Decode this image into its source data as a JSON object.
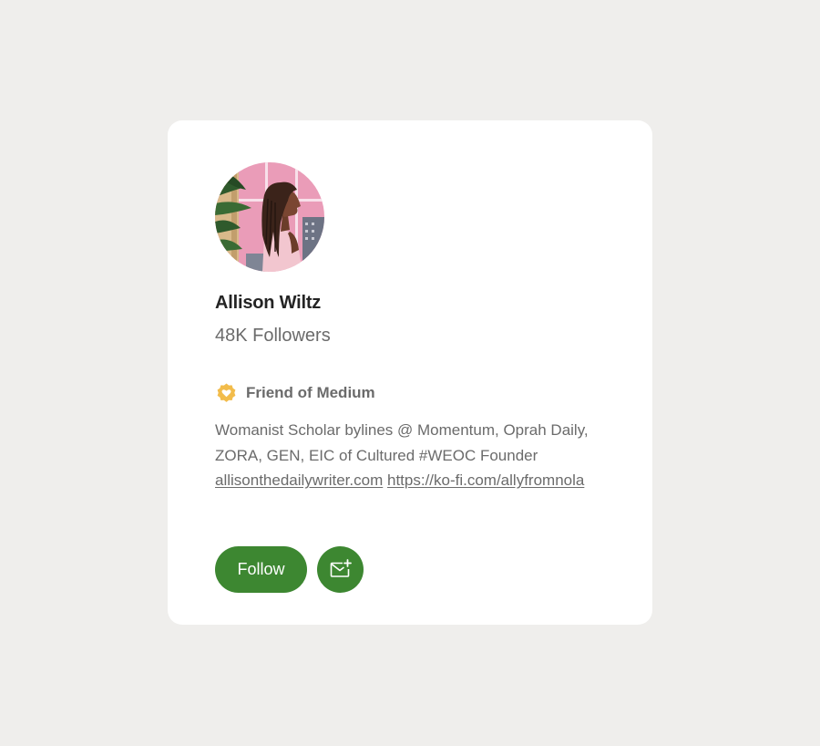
{
  "profile": {
    "name": "Allison Wiltz",
    "followers": "48K Followers",
    "avatar_icon": "profile-avatar-illustration"
  },
  "badge": {
    "label": "Friend of Medium",
    "icon": "heart-badge-icon",
    "color": "#f2bc4b"
  },
  "bio": {
    "text_prefix": "Womanist Scholar bylines @ Momentum, Oprah Daily, ZORA, GEN, EIC of Cultured #WEOC Founder ",
    "link1": "allisonthedailywriter.com",
    "separator": " ",
    "link2": "https://ko-fi.com/allyfromnola"
  },
  "actions": {
    "follow_label": "Follow",
    "subscribe_icon": "mail-plus-icon",
    "accent_color": "#3d8731"
  }
}
